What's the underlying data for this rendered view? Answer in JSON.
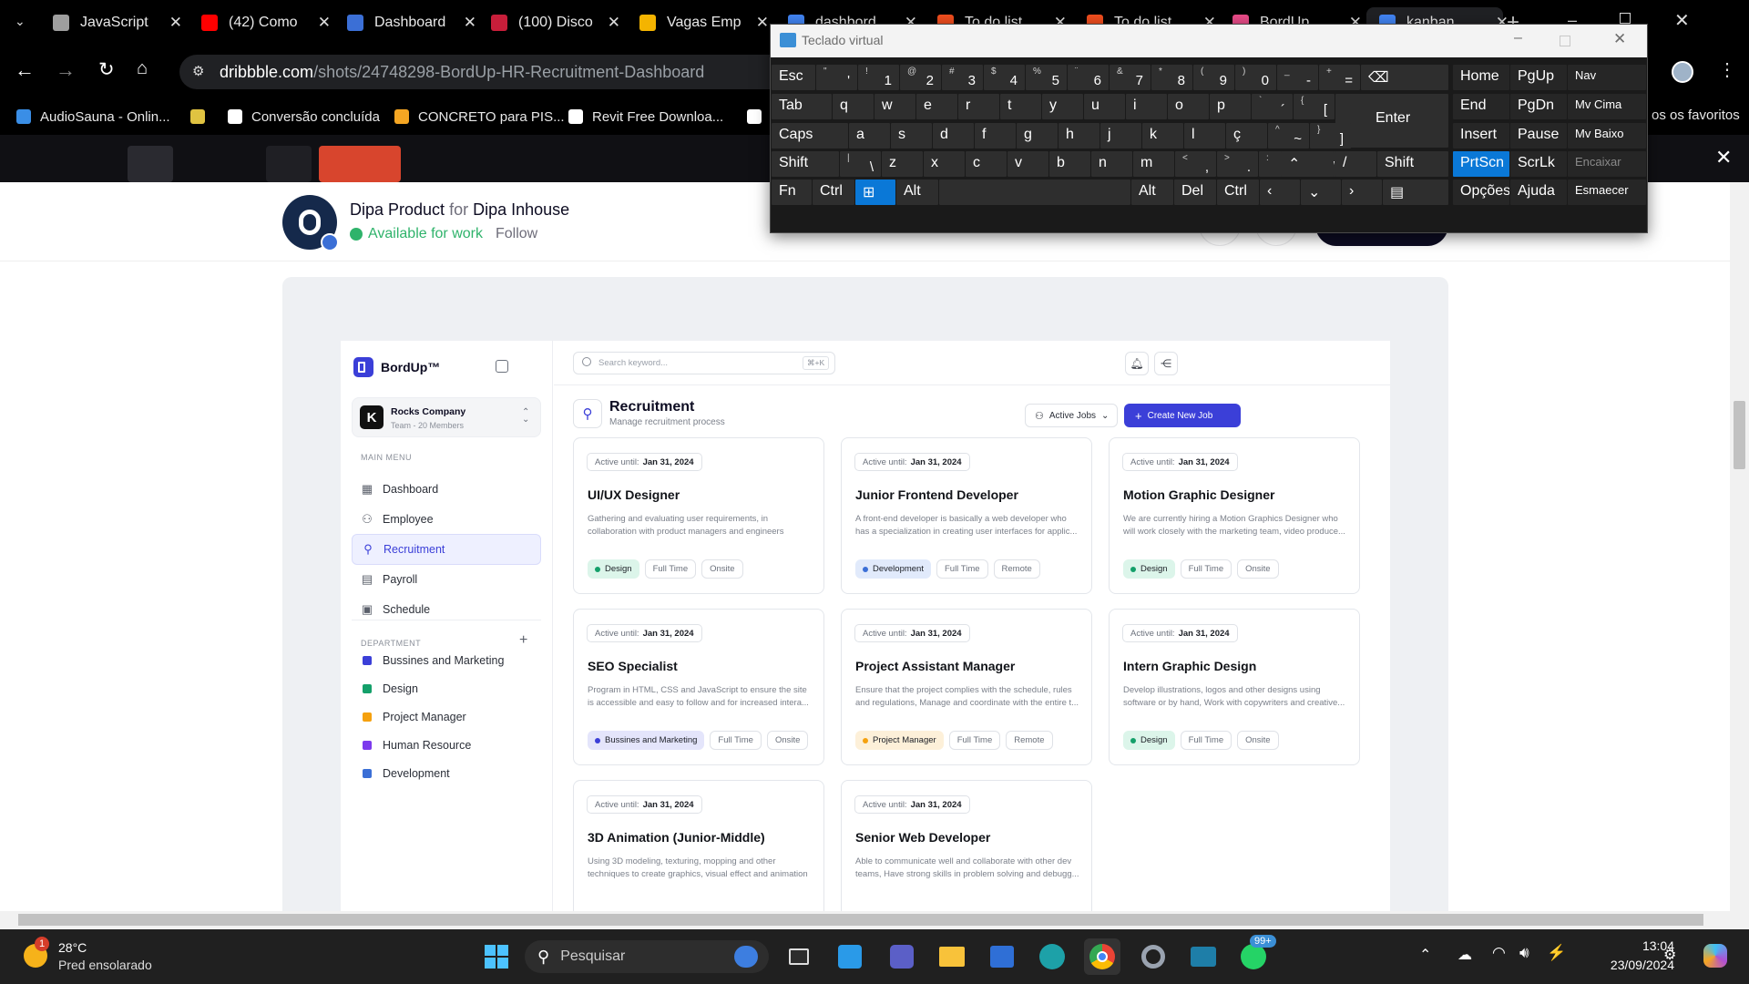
{
  "browser": {
    "tabs": [
      {
        "title": "JavaScript",
        "icon": "audio-wave-icon",
        "color": "#9e9e9e"
      },
      {
        "title": "(42) Como",
        "icon": "youtube-icon",
        "color": "#ff0000"
      },
      {
        "title": "Dashboard",
        "icon": "code-icon",
        "color": "#3b6fd6"
      },
      {
        "title": "(100) Disco",
        "icon": "badge-100-icon",
        "color": "#c81e3a"
      },
      {
        "title": "Vagas Emp",
        "icon": "drive-icon",
        "color": "#f4b400"
      },
      {
        "title": "dashbord",
        "icon": "google-icon",
        "color": "#4285f4"
      },
      {
        "title": "To do list",
        "icon": "figma-icon",
        "color": "#f24e1e"
      },
      {
        "title": "To do list",
        "icon": "figma-icon",
        "color": "#f24e1e"
      },
      {
        "title": "BordUp",
        "icon": "dribbble-icon",
        "color": "#ea4c89"
      },
      {
        "title": "kanban",
        "icon": "google-icon",
        "color": "#4285f4"
      }
    ],
    "new_tab": "+",
    "url_domain": "dribbble.com",
    "url_path": "/shots/24748298-BordUp-HR-Recruitment-Dashboard",
    "bookmarks": [
      {
        "label": "AudioSauna - Onlin...",
        "color": "#3a8ee6"
      },
      {
        "label": "",
        "color": "#e0c341"
      },
      {
        "label": "Conversão concluída",
        "color": "#ffffff"
      },
      {
        "label": "CONCRETO para PIS...",
        "color": "#f5a623"
      },
      {
        "label": "Revit Free Downloa...",
        "color": "#ffffff"
      },
      {
        "label": "",
        "color": "#ffffff"
      }
    ],
    "favorites_text": "os os favoritos"
  },
  "dribbble": {
    "author": "Dipa Product",
    "for_text": "for",
    "team": "Dipa Inhouse",
    "availability": "Available for work",
    "follow": "Follow"
  },
  "app": {
    "brand": "BordUp™",
    "search_placeholder": "Search keyword...",
    "search_shortcut": "⌘+K",
    "workspace": {
      "name": "Rocks Company",
      "sub": "Team - 20 Members"
    },
    "main_menu_label": "MAIN MENU",
    "nav": [
      "Dashboard",
      "Employee",
      "Recruitment",
      "Payroll",
      "Schedule"
    ],
    "department_label": "DEPARTMENT",
    "departments": [
      {
        "name": "Bussines and Marketing",
        "color": "#3b3fd8"
      },
      {
        "name": "Design",
        "color": "#14a06a"
      },
      {
        "name": "Project Manager",
        "color": "#f5a10f"
      },
      {
        "name": "Human Resource",
        "color": "#7c3aed"
      },
      {
        "name": "Development",
        "color": "#3b6fd6"
      }
    ],
    "page_title": "Recruitment",
    "page_subtitle": "Manage recruitment process",
    "filter_label": "Active Jobs",
    "create_label": "Create New Job",
    "active_until_label": "Active until:",
    "jobs": [
      {
        "date": "Jan 31, 2024",
        "title": "UI/UX Designer",
        "desc": "Gathering and evaluating user requirements, in collaboration with product managers and engineers",
        "dept": "Design",
        "dept_color": "#14a06a",
        "dept_bg": "#dcf5ea",
        "type": "Full Time",
        "mode": "Onsite"
      },
      {
        "date": "Jan 31, 2024",
        "title": "Junior Frontend Developer",
        "desc": "A front-end developer is basically a web developer who has a specialization in creating user interfaces for applic...",
        "dept": "Development",
        "dept_color": "#3b6fd6",
        "dept_bg": "#e1eafb",
        "type": "Full Time",
        "mode": "Remote"
      },
      {
        "date": "Jan 31, 2024",
        "title": "Motion Graphic Designer",
        "desc": "We are currently hiring a Motion Graphics Designer who will work closely with the marketing team, video produce...",
        "dept": "Design",
        "dept_color": "#14a06a",
        "dept_bg": "#dcf5ea",
        "type": "Full Time",
        "mode": "Onsite"
      },
      {
        "date": "Jan 31, 2024",
        "title": "SEO Specialist",
        "desc": "Program in HTML, CSS and JavaScript to ensure the site is accessible and easy to follow and for increased intera...",
        "dept": "Bussines and Marketing",
        "dept_color": "#3b3fd8",
        "dept_bg": "#e4e5fb",
        "type": "Full Time",
        "mode": "Onsite"
      },
      {
        "date": "Jan 31, 2024",
        "title": "Project Assistant Manager",
        "desc": "Ensure that the project complies with the schedule, rules and regulations, Manage and coordinate with the entire t...",
        "dept": "Project Manager",
        "dept_color": "#f5a10f",
        "dept_bg": "#fdf0d9",
        "type": "Full Time",
        "mode": "Remote"
      },
      {
        "date": "Jan 31, 2024",
        "title": "Intern Graphic Design",
        "desc": "Develop illustrations, logos and other designs using software or by hand, Work with copywriters and creative...",
        "dept": "Design",
        "dept_color": "#14a06a",
        "dept_bg": "#dcf5ea",
        "type": "Full Time",
        "mode": "Onsite"
      },
      {
        "date": "Jan 31, 2024",
        "title": "3D Animation (Junior-Middle)",
        "desc": "Using 3D modeling, texturing, mopping and other techniques to create graphics, visual effect and animation",
        "dept": "",
        "dept_color": "",
        "dept_bg": "",
        "type": "",
        "mode": ""
      },
      {
        "date": "Jan 31, 2024",
        "title": "Senior Web Developer",
        "desc": "Able to communicate well and collaborate with other dev teams, Have strong skills in problem solving and debugg...",
        "dept": "",
        "dept_color": "",
        "dept_bg": "",
        "type": "",
        "mode": ""
      }
    ]
  },
  "osk": {
    "title": "Teclado virtual",
    "keys": {
      "esc": "Esc",
      "tab": "Tab",
      "caps": "Caps",
      "shift": "Shift",
      "fn": "Fn",
      "ctrl": "Ctrl",
      "alt": "Alt",
      "enter": "Enter",
      "del": "Del",
      "home": "Home",
      "pgup": "PgUp",
      "nav": "Nav",
      "end": "End",
      "pgdn": "PgDn",
      "mvcima": "Mv Cima",
      "insert": "Insert",
      "pause": "Pause",
      "mvbaixo": "Mv Baixo",
      "prtscn": "PrtScn",
      "scrlk": "ScrLk",
      "encaixar": "Encaixar",
      "opcoes": "Opções",
      "ajuda": "Ajuda",
      "esmaecer": "Esmaecer"
    },
    "row1": [
      [
        "'",
        "\""
      ],
      [
        "1",
        "!"
      ],
      [
        "2",
        "@"
      ],
      [
        "3",
        "#"
      ],
      [
        "4",
        "$"
      ],
      [
        "5",
        "%"
      ],
      [
        "6",
        "¨"
      ],
      [
        "7",
        "&"
      ],
      [
        "8",
        "*"
      ],
      [
        "9",
        "("
      ],
      [
        "0",
        ")"
      ],
      [
        "-",
        "_"
      ],
      [
        "=",
        "+"
      ]
    ],
    "row2": [
      "q",
      "w",
      "e",
      "r",
      "t",
      "y",
      "u",
      "i",
      "o",
      "p"
    ],
    "row2_extra": [
      [
        "´",
        "`"
      ],
      [
        "[",
        "{"
      ]
    ],
    "row3": [
      "a",
      "s",
      "d",
      "f",
      "g",
      "h",
      "j",
      "k",
      "l",
      "ç"
    ],
    "row3_extra": [
      [
        "~",
        "^"
      ],
      [
        "]",
        "}"
      ]
    ],
    "row4": [
      [
        "\\",
        "|"
      ],
      [
        "z",
        ""
      ],
      [
        "x",
        ""
      ],
      [
        "c",
        ""
      ],
      [
        "v",
        ""
      ],
      [
        "b",
        ""
      ],
      [
        "n",
        ""
      ],
      [
        "m",
        ""
      ],
      [
        ",",
        "<"
      ],
      [
        ".",
        ">"
      ],
      [
        ";",
        ":"
      ],
      [
        "/",
        "?"
      ]
    ]
  },
  "taskbar": {
    "temperature": "28°C",
    "weather": "Pred ensolarado",
    "weather_badge": "1",
    "search": "Pesquisar",
    "time": "13:04",
    "date": "23/09/2024",
    "notif_badge": "99+"
  }
}
